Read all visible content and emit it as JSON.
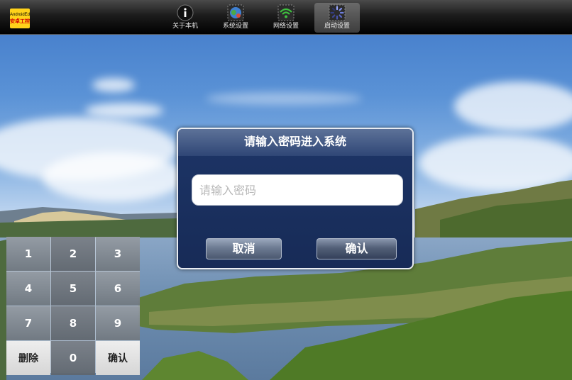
{
  "topbar": {
    "logo": {
      "line1": "AndroidEd",
      "line2": "安卓工控"
    },
    "tabs": [
      {
        "label": "关于本机",
        "icon": "info-icon",
        "active": false
      },
      {
        "label": "系统设置",
        "icon": "globe-settings-icon",
        "active": false
      },
      {
        "label": "网络设置",
        "icon": "wifi-icon",
        "active": false
      },
      {
        "label": "启动设置",
        "icon": "loading-spinner-icon",
        "active": true
      }
    ]
  },
  "dialog": {
    "title": "请输入密码进入系统",
    "password": {
      "value": "",
      "placeholder": "请输入密码"
    },
    "cancel_label": "取消",
    "confirm_label": "确认"
  },
  "keypad": {
    "keys": [
      "1",
      "2",
      "3",
      "4",
      "5",
      "6",
      "7",
      "8",
      "9",
      "删除",
      "0",
      "确认"
    ]
  },
  "colors": {
    "dialog_bg": "#172b57",
    "dialog_title_bg": "#2f4676",
    "topbar_bg": "#000000",
    "logo_bg": "#ffd21a"
  }
}
